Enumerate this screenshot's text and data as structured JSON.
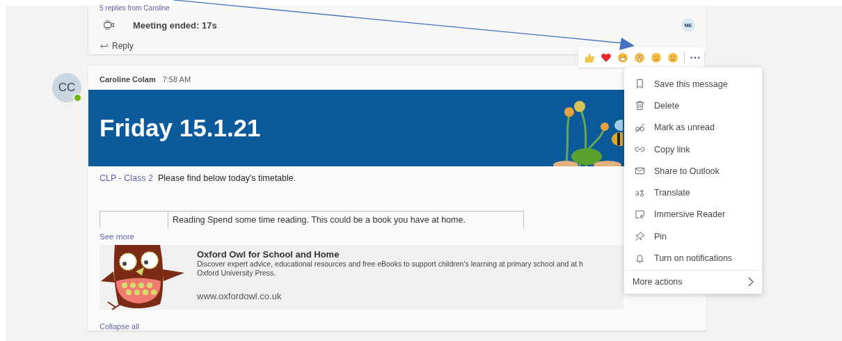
{
  "thread": {
    "replies_link": "5 replies from Caroline",
    "meeting_text": "Meeting ended: 17s",
    "reply_label": "Reply",
    "participant_initials": "ME"
  },
  "message": {
    "avatar_initials": "CC",
    "presence_available": true,
    "author": "Caroline Colam",
    "time": "7:58 AM",
    "banner_title": "Friday 15.1.21",
    "channel_link": "CLP - Class 2",
    "body": "Please find below today's timetable.",
    "table_rows": [
      {
        "column_1": "",
        "column_2": "Reading Spend some time reading. This could be a book you have at home."
      }
    ],
    "see_more": "See more",
    "link_preview": {
      "title": "Oxford Owl for School and Home",
      "description_line_1": "Discover expert advice, educational resources and free eBooks to support children's learning at primary school and at h",
      "description_line_2": "Oxford University Press.",
      "url": "www.oxfordowl.co.uk"
    },
    "collapse_all": "Collapse all"
  },
  "context_menu": {
    "items": [
      {
        "label": "Save this message"
      },
      {
        "label": "Delete"
      },
      {
        "label": "Mark as unread"
      },
      {
        "label": "Copy link"
      },
      {
        "label": "Share to Outlook"
      },
      {
        "label": "Translate"
      },
      {
        "label": "Immersive Reader"
      },
      {
        "label": "Pin"
      },
      {
        "label": "Turn on notifications"
      }
    ],
    "more_actions": "More actions"
  }
}
